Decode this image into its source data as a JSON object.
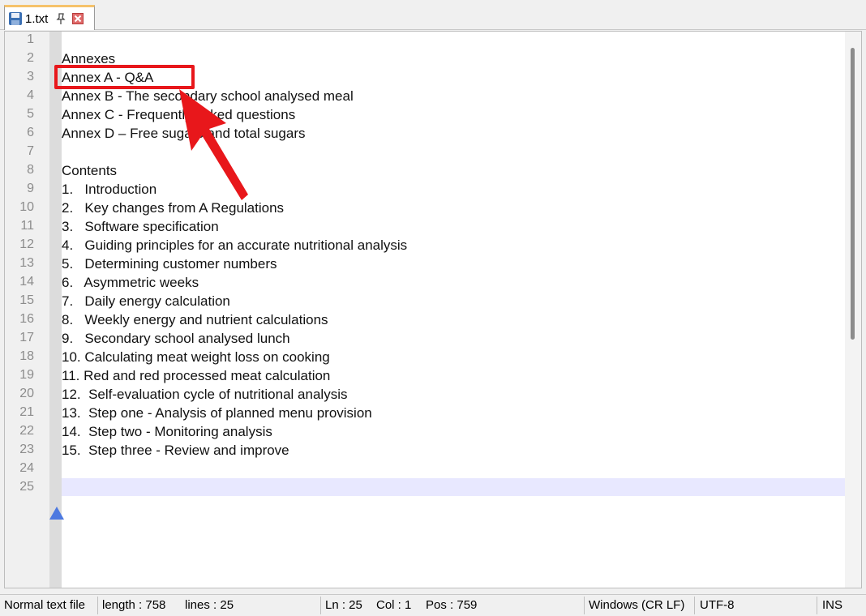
{
  "tab": {
    "label": "1.txt",
    "icons": [
      "save-icon",
      "pin-icon",
      "close-icon"
    ]
  },
  "editor": {
    "line_numbers": [
      "1",
      "2",
      "3",
      "4",
      "5",
      "6",
      "7",
      "8",
      "9",
      "10",
      "11",
      "12",
      "13",
      "14",
      "15",
      "16",
      "17",
      "18",
      "19",
      "20",
      "21",
      "22",
      "23",
      "24",
      "25"
    ],
    "lines": [
      "",
      "Annexes",
      "Annex A - Q&A",
      "Annex B - The secondary school analysed meal",
      "Annex C - Frequently asked questions",
      "Annex D – Free sugars and total sugars",
      "",
      "Contents",
      "1.   Introduction",
      "2.   Key changes from A Regulations",
      "3.   Software specification",
      "4.   Guiding principles for an accurate nutritional analysis",
      "5.   Determining customer numbers",
      "6.   Asymmetric weeks",
      "7.   Daily energy calculation",
      "8.   Weekly energy and nutrient calculations",
      "9.   Secondary school analysed lunch",
      "10. Calculating meat weight loss on cooking",
      "11. Red and red processed meat calculation",
      "12.  Self-evaluation cycle of nutritional analysis",
      "13.  Step one - Analysis of planned menu provision",
      "14.  Step two - Monitoring analysis",
      "15.  Step three - Review and improve",
      "",
      ""
    ],
    "current_line": 25
  },
  "annotation": {
    "color": "#e8171b",
    "highlighted_line": 3
  },
  "statusbar": {
    "file_type": "Normal text file",
    "length": "length : 758",
    "lines": "lines : 25",
    "ln": "Ln : 25",
    "col": "Col : 1",
    "pos": "Pos : 759",
    "eol": "Windows (CR LF)",
    "encoding": "UTF-8",
    "mode": "INS"
  }
}
